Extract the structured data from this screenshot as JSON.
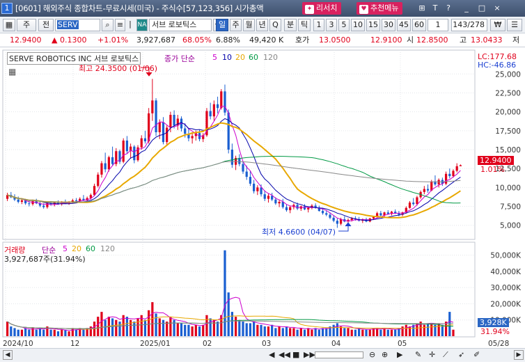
{
  "window": {
    "number": "1",
    "title": "[0601] 해외주식 종합차트-무료시세(미국) - 주식수[57,123,356] 시가총액",
    "btn_research": "리서치",
    "btn_recommend": "추천메뉴",
    "win_controls": [
      "⊞",
      "T",
      "?",
      "_",
      "□",
      "×"
    ]
  },
  "toolbar": {
    "market": "주",
    "exchange": "전",
    "symbol": "SERV",
    "na_badge": "NA",
    "stock_name": "서브 로보틱스",
    "periods": [
      "일",
      "주",
      "월",
      "년",
      "Q",
      "분",
      "틱"
    ],
    "active_period": "일",
    "intervals": [
      "1",
      "3",
      "5",
      "10",
      "15",
      "30",
      "45",
      "60",
      "1"
    ],
    "count": "143/278",
    "currency_icon": "₩"
  },
  "quote": {
    "price": "12.9400",
    "change": "▲  0.1300",
    "change_pct": "+1.01%",
    "volume": "3,927,687",
    "vol_ratio": "68.05%",
    "turnover": "6.88%",
    "amount": "49,420 K",
    "ask_label": "호가",
    "ask": "13.0500",
    "bid": "12.9100",
    "low_label": "시",
    "open": "12.8500",
    "high_label": "고",
    "high": "13.0433",
    "low_trunc": "저"
  },
  "price_panel": {
    "legend_name": "SERVE ROBOTICS INC  서브 로보틱스",
    "ma_label": "종가 단순",
    "ma_periods": [
      "5",
      "10",
      "20",
      "60",
      "120"
    ],
    "ma_colors": [
      "#cc00cc",
      "#0000aa",
      "#e8a800",
      "#009944",
      "#888888"
    ],
    "high_mark": "최고 24.3500 (01/06)",
    "low_mark": "최저 4.6600 (04/07)",
    "lc": "LC:177.68",
    "hc": "HC:-46.86",
    "price_tag": "12.9400",
    "pct_tag": "1.01%",
    "y_ticks": [
      "25,000",
      "22,500",
      "20,000",
      "17,500",
      "15,000",
      "12,500",
      "10,000",
      "7,500",
      "5,000"
    ]
  },
  "volume_panel": {
    "legend": "거래량",
    "ma_label": "단순",
    "ma_periods": [
      "5",
      "20",
      "60",
      "120"
    ],
    "current": "3,927,687주(31.94%)",
    "y_ticks": [
      "50,000K",
      "40,000K",
      "30,000K",
      "20,000K",
      "10,000K"
    ],
    "vol_tag": "3,928K",
    "pct_tag": "31.94%"
  },
  "x_axis": [
    "2024/10",
    "12",
    "2025/01",
    "02",
    "03",
    "04",
    "05",
    "05/28"
  ],
  "chart_data": {
    "type": "candlestick",
    "ylim": [
      3500,
      26500
    ],
    "candles": [
      [
        8500,
        9300,
        8200,
        9000
      ],
      [
        9000,
        9400,
        8600,
        8700
      ],
      [
        8700,
        9100,
        8200,
        8400
      ],
      [
        8400,
        8800,
        7900,
        8100
      ],
      [
        8100,
        8600,
        7800,
        8300
      ],
      [
        8300,
        8500,
        7700,
        7900
      ],
      [
        7900,
        8300,
        7500,
        7800
      ],
      [
        7800,
        8400,
        7600,
        8200
      ],
      [
        8200,
        8500,
        7800,
        7900
      ],
      [
        7900,
        8200,
        7400,
        7600
      ],
      [
        7600,
        7900,
        7200,
        7400
      ],
      [
        7400,
        8000,
        7200,
        7900
      ],
      [
        7900,
        8200,
        7600,
        7800
      ],
      [
        7800,
        8100,
        7500,
        8000
      ],
      [
        8000,
        8300,
        7700,
        7800
      ],
      [
        7800,
        8200,
        7600,
        8100
      ],
      [
        8100,
        8400,
        7800,
        7900
      ],
      [
        7900,
        8200,
        7700,
        8100
      ],
      [
        8100,
        8500,
        7900,
        8300
      ],
      [
        8300,
        8600,
        8000,
        8200
      ],
      [
        8200,
        8700,
        8000,
        8500
      ],
      [
        8500,
        9000,
        8200,
        8300
      ],
      [
        8300,
        8800,
        8100,
        8600
      ],
      [
        8600,
        9200,
        8400,
        9000
      ],
      [
        9000,
        10500,
        8900,
        10200
      ],
      [
        10200,
        12000,
        10000,
        11700
      ],
      [
        11700,
        13500,
        11300,
        13200
      ],
      [
        13200,
        14600,
        12000,
        12400
      ],
      [
        12400,
        14200,
        12100,
        14000
      ],
      [
        14000,
        15400,
        12900,
        13100
      ],
      [
        13100,
        15200,
        12800,
        14800
      ],
      [
        14800,
        15000,
        13100,
        13400
      ],
      [
        13400,
        16500,
        13200,
        16200
      ],
      [
        16200,
        16800,
        14500,
        14800
      ],
      [
        14800,
        15800,
        13800,
        15400
      ],
      [
        15400,
        15600,
        13200,
        13600
      ],
      [
        13600,
        15600,
        13400,
        15300
      ],
      [
        15300,
        16900,
        15000,
        16500
      ],
      [
        16500,
        17500,
        15800,
        16100
      ],
      [
        16100,
        20500,
        15800,
        19800
      ],
      [
        19800,
        24350,
        18800,
        21500
      ],
      [
        21500,
        21800,
        16800,
        17300
      ],
      [
        17300,
        19000,
        16400,
        18600
      ],
      [
        18600,
        19300,
        15700,
        16000
      ],
      [
        16000,
        18200,
        15600,
        17900
      ],
      [
        17900,
        20000,
        17300,
        19600
      ],
      [
        19600,
        20200,
        17800,
        18200
      ],
      [
        18200,
        19600,
        17600,
        19100
      ],
      [
        19100,
        19400,
        17400,
        17800
      ],
      [
        17800,
        18500,
        16600,
        17100
      ],
      [
        17100,
        17800,
        16100,
        16500
      ],
      [
        16500,
        17300,
        15800,
        16800
      ],
      [
        16800,
        17500,
        16200,
        17200
      ],
      [
        17200,
        17600,
        16100,
        16400
      ],
      [
        16400,
        17200,
        16000,
        16900
      ],
      [
        16900,
        20500,
        16700,
        20100
      ],
      [
        20100,
        21200,
        19000,
        19400
      ],
      [
        19400,
        21500,
        18800,
        21000
      ],
      [
        21000,
        22000,
        19800,
        20500
      ],
      [
        20500,
        23000,
        20300,
        22700
      ],
      [
        22700,
        23600,
        19500,
        19900
      ],
      [
        19900,
        20300,
        14500,
        15000
      ],
      [
        15000,
        15800,
        12600,
        13000
      ],
      [
        13000,
        14200,
        12300,
        13900
      ],
      [
        13900,
        14400,
        12800,
        13100
      ],
      [
        13100,
        13500,
        11800,
        12100
      ],
      [
        12100,
        12900,
        11000,
        11400
      ],
      [
        11400,
        12200,
        10200,
        10500
      ],
      [
        10500,
        11000,
        9200,
        9500
      ],
      [
        9500,
        10300,
        9000,
        10000
      ],
      [
        10000,
        10400,
        8800,
        9100
      ],
      [
        9100,
        9600,
        8200,
        8500
      ],
      [
        8500,
        9200,
        8000,
        8900
      ],
      [
        8900,
        9300,
        8200,
        8400
      ],
      [
        8400,
        8700,
        7700,
        7900
      ],
      [
        7900,
        8400,
        7400,
        8100
      ],
      [
        8100,
        8500,
        7200,
        7400
      ],
      [
        7400,
        7800,
        6800,
        7000
      ],
      [
        7000,
        7600,
        6600,
        7400
      ],
      [
        7400,
        7900,
        7100,
        7700
      ],
      [
        7700,
        8000,
        7000,
        7200
      ],
      [
        7200,
        7600,
        6900,
        7500
      ],
      [
        7500,
        7800,
        7000,
        7100
      ],
      [
        7100,
        7500,
        6700,
        7300
      ],
      [
        7300,
        7800,
        7100,
        7600
      ],
      [
        7600,
        7900,
        7200,
        7300
      ],
      [
        7300,
        7600,
        6800,
        6900
      ],
      [
        6900,
        7300,
        6400,
        6600
      ],
      [
        6600,
        7000,
        6200,
        6400
      ],
      [
        6400,
        6700,
        5800,
        6000
      ],
      [
        6000,
        6300,
        5400,
        5600
      ],
      [
        5600,
        5900,
        4660,
        5200
      ],
      [
        5200,
        6000,
        5000,
        5800
      ],
      [
        5800,
        6200,
        5400,
        5500
      ],
      [
        5500,
        5900,
        5200,
        5700
      ],
      [
        5700,
        6100,
        5500,
        5900
      ],
      [
        5900,
        6200,
        5600,
        5800
      ],
      [
        5800,
        6100,
        5500,
        5600
      ],
      [
        5600,
        5900,
        5300,
        5800
      ],
      [
        5800,
        6000,
        5400,
        5500
      ],
      [
        5500,
        6000,
        5400,
        5900
      ],
      [
        5900,
        6200,
        5700,
        6100
      ],
      [
        6100,
        6800,
        6000,
        6600
      ],
      [
        6600,
        6900,
        6200,
        6300
      ],
      [
        6300,
        6800,
        6100,
        6700
      ],
      [
        6700,
        7000,
        6400,
        6500
      ],
      [
        6500,
        6900,
        6300,
        6800
      ],
      [
        6800,
        7100,
        6500,
        6600
      ],
      [
        6600,
        6900,
        6200,
        6400
      ],
      [
        6400,
        6800,
        6200,
        6700
      ],
      [
        6700,
        7500,
        6600,
        7300
      ],
      [
        7300,
        8200,
        7200,
        8000
      ],
      [
        8000,
        8600,
        7600,
        7800
      ],
      [
        7800,
        8900,
        7600,
        8700
      ],
      [
        8700,
        9600,
        8500,
        9400
      ],
      [
        9400,
        10200,
        9100,
        9800
      ],
      [
        9800,
        10400,
        9300,
        9600
      ],
      [
        9600,
        11000,
        9500,
        10800
      ],
      [
        10800,
        11600,
        10200,
        10400
      ],
      [
        10400,
        11200,
        10000,
        11000
      ],
      [
        11000,
        11300,
        10200,
        10500
      ],
      [
        10500,
        12100,
        10300,
        11800
      ],
      [
        11800,
        12500,
        11200,
        11500
      ],
      [
        11500,
        12400,
        11300,
        12200
      ],
      [
        12200,
        13200,
        12000,
        12810
      ],
      [
        12810,
        13043,
        12850,
        12940
      ]
    ],
    "volumes": [
      9,
      6,
      5,
      4,
      4,
      5,
      4,
      5,
      4,
      5,
      4,
      6,
      4,
      4,
      3,
      4,
      4,
      3,
      5,
      4,
      5,
      4,
      5,
      6,
      9,
      12,
      15,
      10,
      12,
      11,
      10,
      9,
      13,
      12,
      10,
      9,
      11,
      13,
      10,
      16,
      21,
      14,
      11,
      10,
      9,
      12,
      10,
      8,
      8,
      7,
      7,
      6,
      7,
      6,
      7,
      13,
      11,
      10,
      9,
      13,
      53,
      27,
      15,
      12,
      10,
      9,
      8,
      8,
      9,
      7,
      7,
      6,
      6,
      7,
      5,
      6,
      5,
      6,
      5,
      5,
      4,
      5,
      4,
      5,
      4,
      5,
      4,
      5,
      5,
      6,
      7,
      8,
      6,
      5,
      5,
      4,
      4,
      5,
      4,
      4,
      4,
      5,
      5,
      4,
      5,
      4,
      4,
      4,
      5,
      6,
      7,
      6,
      7,
      8,
      9,
      7,
      8,
      8,
      7,
      8,
      7,
      9,
      15,
      4
    ]
  }
}
